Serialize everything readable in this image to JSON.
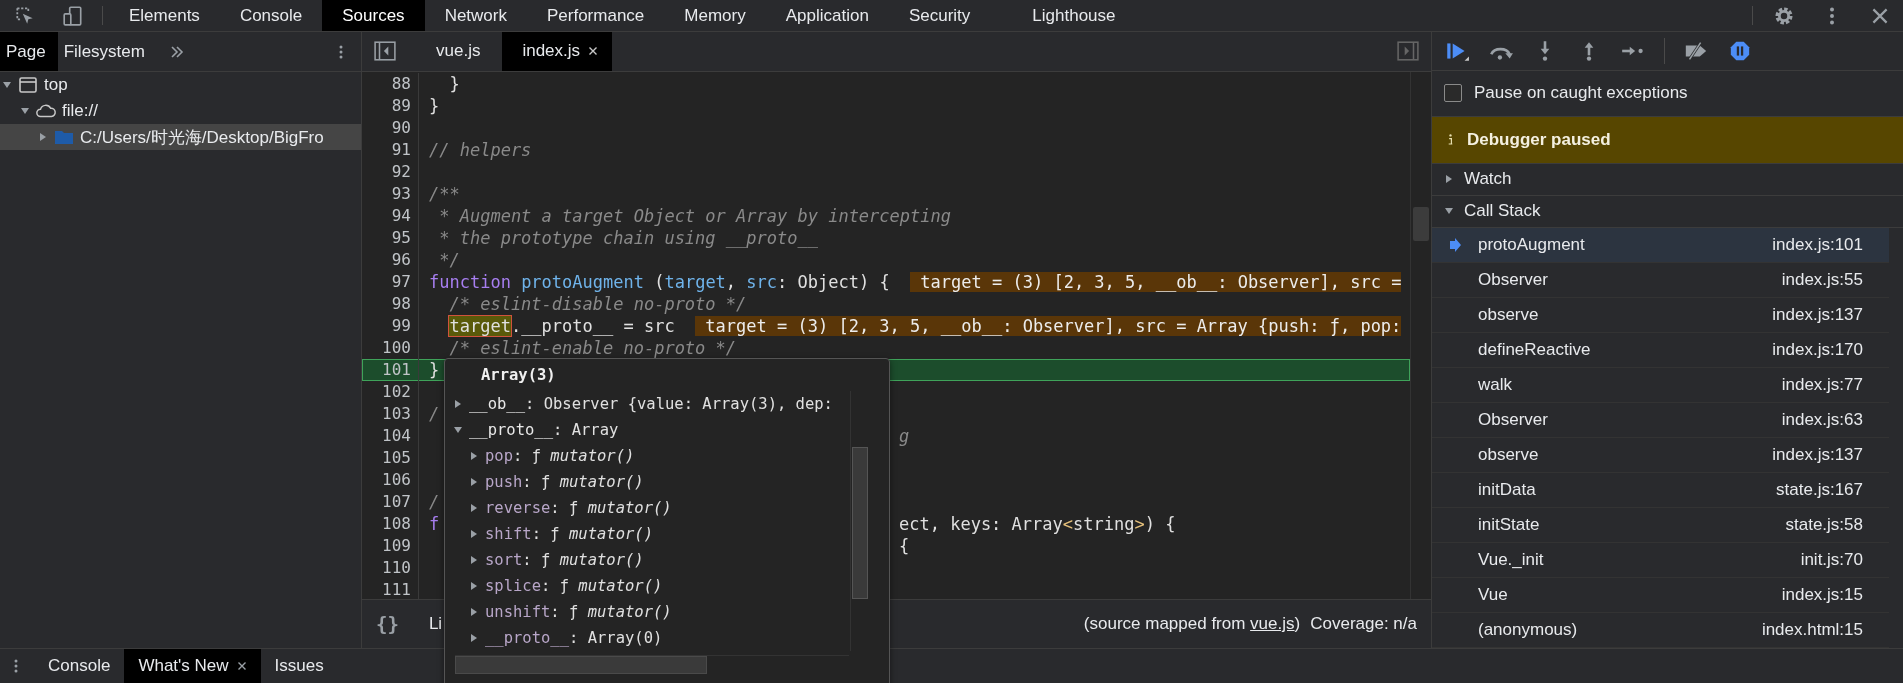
{
  "top_tabs": [
    {
      "label": "Elements",
      "selected": false
    },
    {
      "label": "Console",
      "selected": false
    },
    {
      "label": "Sources",
      "selected": true
    },
    {
      "label": "Network",
      "selected": false
    },
    {
      "label": "Performance",
      "selected": false
    },
    {
      "label": "Memory",
      "selected": false
    },
    {
      "label": "Application",
      "selected": false
    },
    {
      "label": "Security",
      "selected": false
    },
    {
      "label": "Lighthouse",
      "selected": false
    }
  ],
  "navigator": {
    "tabs": [
      {
        "label": "Page",
        "selected": true
      },
      {
        "label": "Filesystem",
        "selected": false
      }
    ],
    "tree": [
      {
        "label": "top",
        "expanded": true,
        "selected": false,
        "children": [
          {
            "label": "file://",
            "expanded": true,
            "selected": false,
            "children": [
              {
                "label": "C:/Users/时光海/Desktop/BigFro",
                "expanded": false,
                "selected": true
              }
            ]
          }
        ]
      }
    ]
  },
  "editor": {
    "tabs": [
      {
        "label": "vue.js",
        "selected": false,
        "closable": false
      },
      {
        "label": "index.js",
        "selected": true,
        "closable": true
      }
    ],
    "lines": [
      {
        "number": "88",
        "paused": false,
        "segments": [
          {
            "kind": "plain",
            "text": "  }"
          }
        ]
      },
      {
        "number": "89",
        "paused": false,
        "segments": [
          {
            "kind": "plain",
            "text": "}"
          }
        ]
      },
      {
        "number": "90",
        "paused": false
      },
      {
        "number": "91",
        "paused": false,
        "segments": [
          {
            "kind": "comment",
            "text": "// helpers"
          }
        ]
      },
      {
        "number": "92",
        "paused": false
      },
      {
        "number": "93",
        "paused": false,
        "segments": [
          {
            "kind": "comment",
            "text": "/**"
          }
        ]
      },
      {
        "number": "94",
        "paused": false,
        "segments": [
          {
            "kind": "comment",
            "text": " * Augment a target Object or Array by intercepting"
          }
        ]
      },
      {
        "number": "95",
        "paused": false,
        "segments": [
          {
            "kind": "comment",
            "text": " * the prototype chain using __proto__"
          }
        ]
      },
      {
        "number": "96",
        "paused": false,
        "segments": [
          {
            "kind": "comment",
            "text": " */"
          }
        ]
      },
      {
        "number": "97",
        "paused": false,
        "segments": [
          {
            "kind": "keyword",
            "text": "function "
          },
          {
            "kind": "def",
            "text": "protoAugment"
          },
          {
            "kind": "plain",
            "text": " ("
          },
          {
            "kind": "var",
            "text": "target"
          },
          {
            "kind": "plain",
            "text": ", "
          },
          {
            "kind": "var",
            "text": "src"
          },
          {
            "kind": "plain",
            "text": ": Object) {  "
          },
          {
            "kind": "value",
            "text": " target = (3) [2, 3, 5, __ob__: Observer], src ="
          }
        ]
      },
      {
        "number": "98",
        "paused": false,
        "segments": [
          {
            "kind": "comment",
            "text": "  /* eslint-disable no-proto */"
          }
        ]
      },
      {
        "number": "99",
        "paused": false,
        "segments": [
          {
            "kind": "hover",
            "text": "target"
          },
          {
            "kind": "plain",
            "text": ".__proto__ = src  "
          },
          {
            "kind": "value",
            "text": " target = (3) [2, 3, 5, __ob__: Observer], src = Array {push: ƒ, pop:"
          }
        ]
      },
      {
        "number": "100",
        "paused": false,
        "segments": [
          {
            "kind": "comment",
            "text": "  /* eslint-enable no-proto */"
          }
        ]
      },
      {
        "number": "101",
        "paused": true,
        "segments": [
          {
            "kind": "plain",
            "text": "}"
          }
        ]
      },
      {
        "number": "102",
        "paused": false
      },
      {
        "number": "103",
        "paused": false,
        "segments": [
          {
            "kind": "comment",
            "text": "/"
          }
        ]
      },
      {
        "number": "104",
        "paused": false,
        "tail": [
          {
            "kind": "comment",
            "text": "g"
          }
        ]
      },
      {
        "number": "105",
        "paused": false
      },
      {
        "number": "106",
        "paused": false
      },
      {
        "number": "107",
        "paused": false,
        "segments": [
          {
            "kind": "comment",
            "text": "/"
          }
        ]
      },
      {
        "number": "108",
        "paused": false,
        "segments": [
          {
            "kind": "keyword",
            "text": "f"
          }
        ],
        "tail": [
          {
            "kind": "plain",
            "text": "ect, keys: Array"
          },
          {
            "kind": "punct",
            "text": "<"
          },
          {
            "kind": "plain",
            "text": "string"
          },
          {
            "kind": "punct",
            "text": ">"
          },
          {
            "kind": "plain",
            "text": ") {"
          }
        ]
      },
      {
        "number": "109",
        "paused": false,
        "tail": [
          {
            "kind": "plain",
            "text": "{"
          }
        ]
      },
      {
        "number": "110",
        "paused": false
      },
      {
        "number": "111",
        "paused": false
      }
    ],
    "status": {
      "pretty_print": "{}",
      "position": "Li",
      "source_prefix": "(source mapped from ",
      "source_link": "vue.js",
      "source_suffix": ")",
      "coverage": "Coverage: n/a"
    }
  },
  "popup": {
    "title": "Array(3)",
    "properties": [
      {
        "name": "__ob__",
        "value": ": Observer {value: Array(3), dep:",
        "expanded": false,
        "dimmed": false
      },
      {
        "name": "__proto__",
        "value": ": Array",
        "expanded": true,
        "dimmed": false,
        "children": [
          {
            "name": "pop",
            "value": ": ƒ *mutator()*",
            "expanded": false,
            "dimmed": true
          },
          {
            "name": "push",
            "value": ": ƒ *mutator()*",
            "expanded": false,
            "dimmed": true
          },
          {
            "name": "reverse",
            "value": ": ƒ *mutator()*",
            "expanded": false,
            "dimmed": true
          },
          {
            "name": "shift",
            "value": ": ƒ *mutator()*",
            "expanded": false,
            "dimmed": true
          },
          {
            "name": "sort",
            "value": ": ƒ *mutator()*",
            "expanded": false,
            "dimmed": true
          },
          {
            "name": "splice",
            "value": ": ƒ *mutator()*",
            "expanded": false,
            "dimmed": true
          },
          {
            "name": "unshift",
            "value": ": ƒ *mutator()*",
            "expanded": false,
            "dimmed": true
          },
          {
            "name": "__proto__",
            "value": ": Array(0)",
            "expanded": false,
            "dimmed": true
          }
        ]
      }
    ]
  },
  "debugger": {
    "breakpoints_deactivated": false,
    "pause_on_exceptions": true,
    "caught_exceptions": {
      "label": "Pause on caught exceptions",
      "checked": false
    },
    "banner": "Debugger paused",
    "sections": [
      {
        "label": "Watch",
        "expanded": false
      },
      {
        "label": "Call Stack",
        "expanded": true
      }
    ],
    "call_stack": [
      {
        "name": "protoAugment",
        "location": "index.js:101",
        "selected": true
      },
      {
        "name": "Observer",
        "location": "index.js:55",
        "selected": false
      },
      {
        "name": "observe",
        "location": "index.js:137",
        "selected": false
      },
      {
        "name": "defineReactive",
        "location": "index.js:170",
        "selected": false
      },
      {
        "name": "walk",
        "location": "index.js:77",
        "selected": false
      },
      {
        "name": "Observer",
        "location": "index.js:63",
        "selected": false
      },
      {
        "name": "observe",
        "location": "index.js:137",
        "selected": false
      },
      {
        "name": "initData",
        "location": "state.js:167",
        "selected": false
      },
      {
        "name": "initState",
        "location": "state.js:58",
        "selected": false
      },
      {
        "name": "Vue._init",
        "location": "init.js:70",
        "selected": false
      },
      {
        "name": "Vue",
        "location": "index.js:15",
        "selected": false
      },
      {
        "name": "(anonymous)",
        "location": "index.html:15",
        "selected": false
      }
    ]
  },
  "drawer": {
    "tabs": [
      {
        "label": "Console",
        "selected": false,
        "closable": false
      },
      {
        "label": "What's New",
        "selected": true,
        "closable": true
      },
      {
        "label": "Issues",
        "selected": false,
        "closable": false
      }
    ]
  }
}
